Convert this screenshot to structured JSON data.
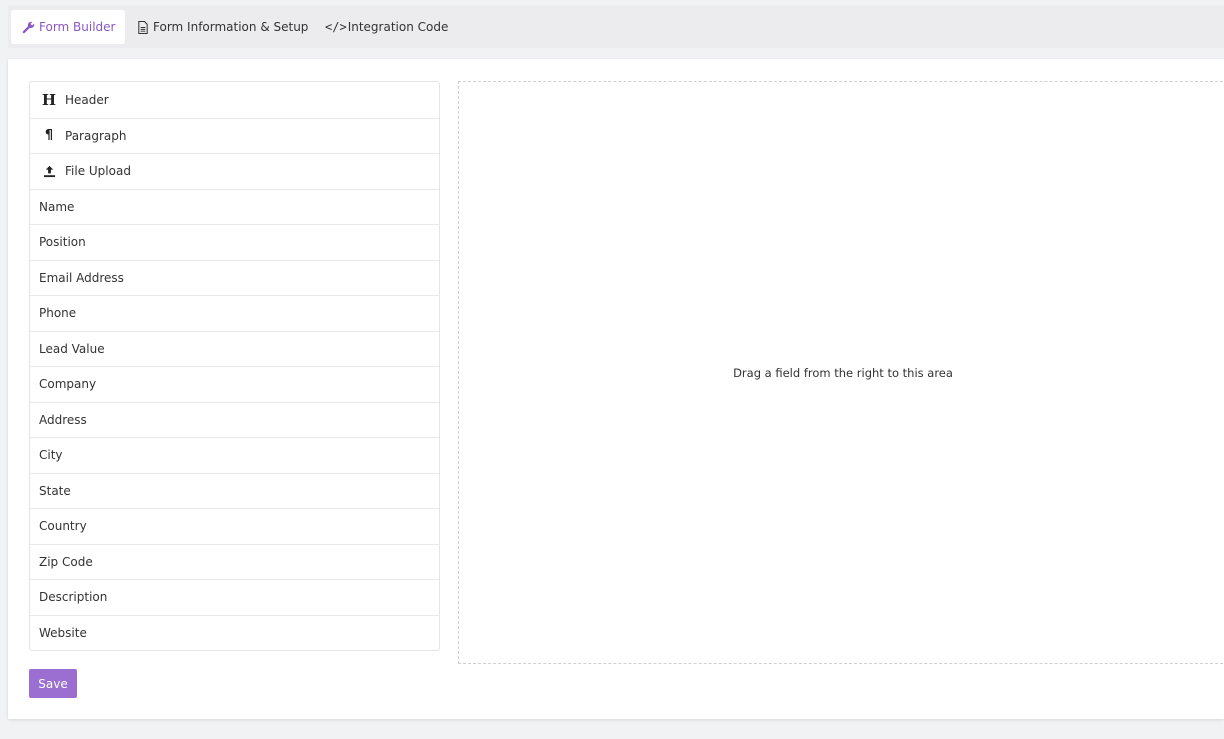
{
  "tabs": [
    {
      "label": "Form Builder",
      "icon": "wrench-icon",
      "active": true
    },
    {
      "label": "Form Information & Setup",
      "icon": "document-icon",
      "active": false
    },
    {
      "label": "Integration Code",
      "icon": "code-icon",
      "active": false
    }
  ],
  "fields": [
    {
      "label": "Header",
      "icon": "header-icon"
    },
    {
      "label": "Paragraph",
      "icon": "paragraph-icon"
    },
    {
      "label": "File Upload",
      "icon": "upload-icon"
    },
    {
      "label": "Name"
    },
    {
      "label": "Position"
    },
    {
      "label": "Email Address"
    },
    {
      "label": "Phone"
    },
    {
      "label": "Lead Value"
    },
    {
      "label": "Company"
    },
    {
      "label": "Address"
    },
    {
      "label": "City"
    },
    {
      "label": "State"
    },
    {
      "label": "Country"
    },
    {
      "label": "Zip Code"
    },
    {
      "label": "Description"
    },
    {
      "label": "Website"
    }
  ],
  "drop_zone": {
    "hint": "Drag a field from the right to this area"
  },
  "save_label": "Save",
  "colors": {
    "accent": "#9b6fd1",
    "active_tab_text": "#8a57c4"
  }
}
